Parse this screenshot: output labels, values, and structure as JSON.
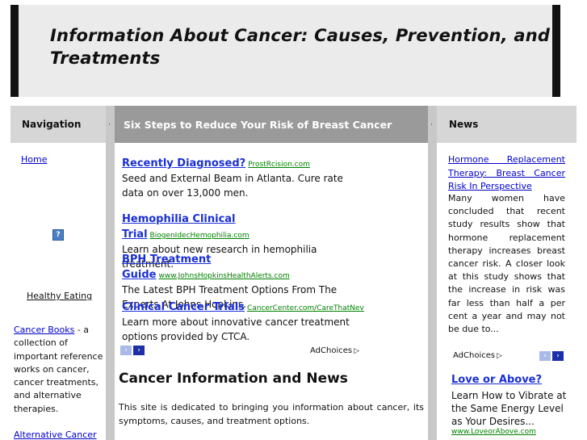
{
  "header": {
    "title": "Information About Cancer: Causes, Prevention, and Treatments"
  },
  "left": {
    "heading": "Navigation",
    "home": "Home",
    "help_icon": "?",
    "healthy_eating": "Healthy Eating",
    "cancer_books_link": "Cancer Books",
    "cancer_books_text": " - a collection of important reference works on cancer, cancer treatments, and alternative therapies.",
    "alternative_cancer": "Alternative Cancer"
  },
  "center": {
    "heading": "Six Steps to Reduce Your Risk of Breast Cancer",
    "ads": [
      {
        "title": "Recently Diagnosed?",
        "url": "ProstRcision.com",
        "text": "Seed and External Beam in Atlanta. Cure rate data on over 13,000 men."
      },
      {
        "title": "Hemophilia Clinical Trial",
        "url": "BiogenIdecHemophilia.com",
        "text": "Learn about new research in hemophilia treatment."
      },
      {
        "title": "BPH Treatment Guide",
        "url": "www.JohnsHopkinsHealthAlerts.com",
        "text": "The Latest BPH Treatment Options From The Experts At Johns Hopkins."
      },
      {
        "title": "Clinical Cancer Trials",
        "url": "CancerCenter.com/CareThatNeverQuits",
        "text": "Learn more about innovative cancer treatment options provided by CTCA."
      }
    ],
    "adchoices": "AdChoices",
    "section_heading": "Cancer Information and News",
    "intro": "This site is dedicated to bringing you information about cancer, its symptoms, causes, and treatment options."
  },
  "right": {
    "heading": "News",
    "news_link": "Hormone Replacement Therapy: Breast Cancer Risk In Perspective",
    "news_text": "Many women have concluded that recent study results show that hormone replacement therapy increases breast cancer risk. A closer look at this study shows that the increase in risk was far less than half a per cent a year and may not be due to...",
    "adchoices": "AdChoices",
    "ad": {
      "title": "Love or Above?",
      "text": "Learn How to Vibrate at the Same Energy Level as Your Desires...",
      "url": "www.LoveorAbove.com"
    }
  },
  "colors": {
    "ad_title": "#1a2fd6",
    "ad_url": "#008000",
    "link": "#0000cc",
    "header_bar": "#111111",
    "center_heading_bg": "#9a9a9a"
  }
}
